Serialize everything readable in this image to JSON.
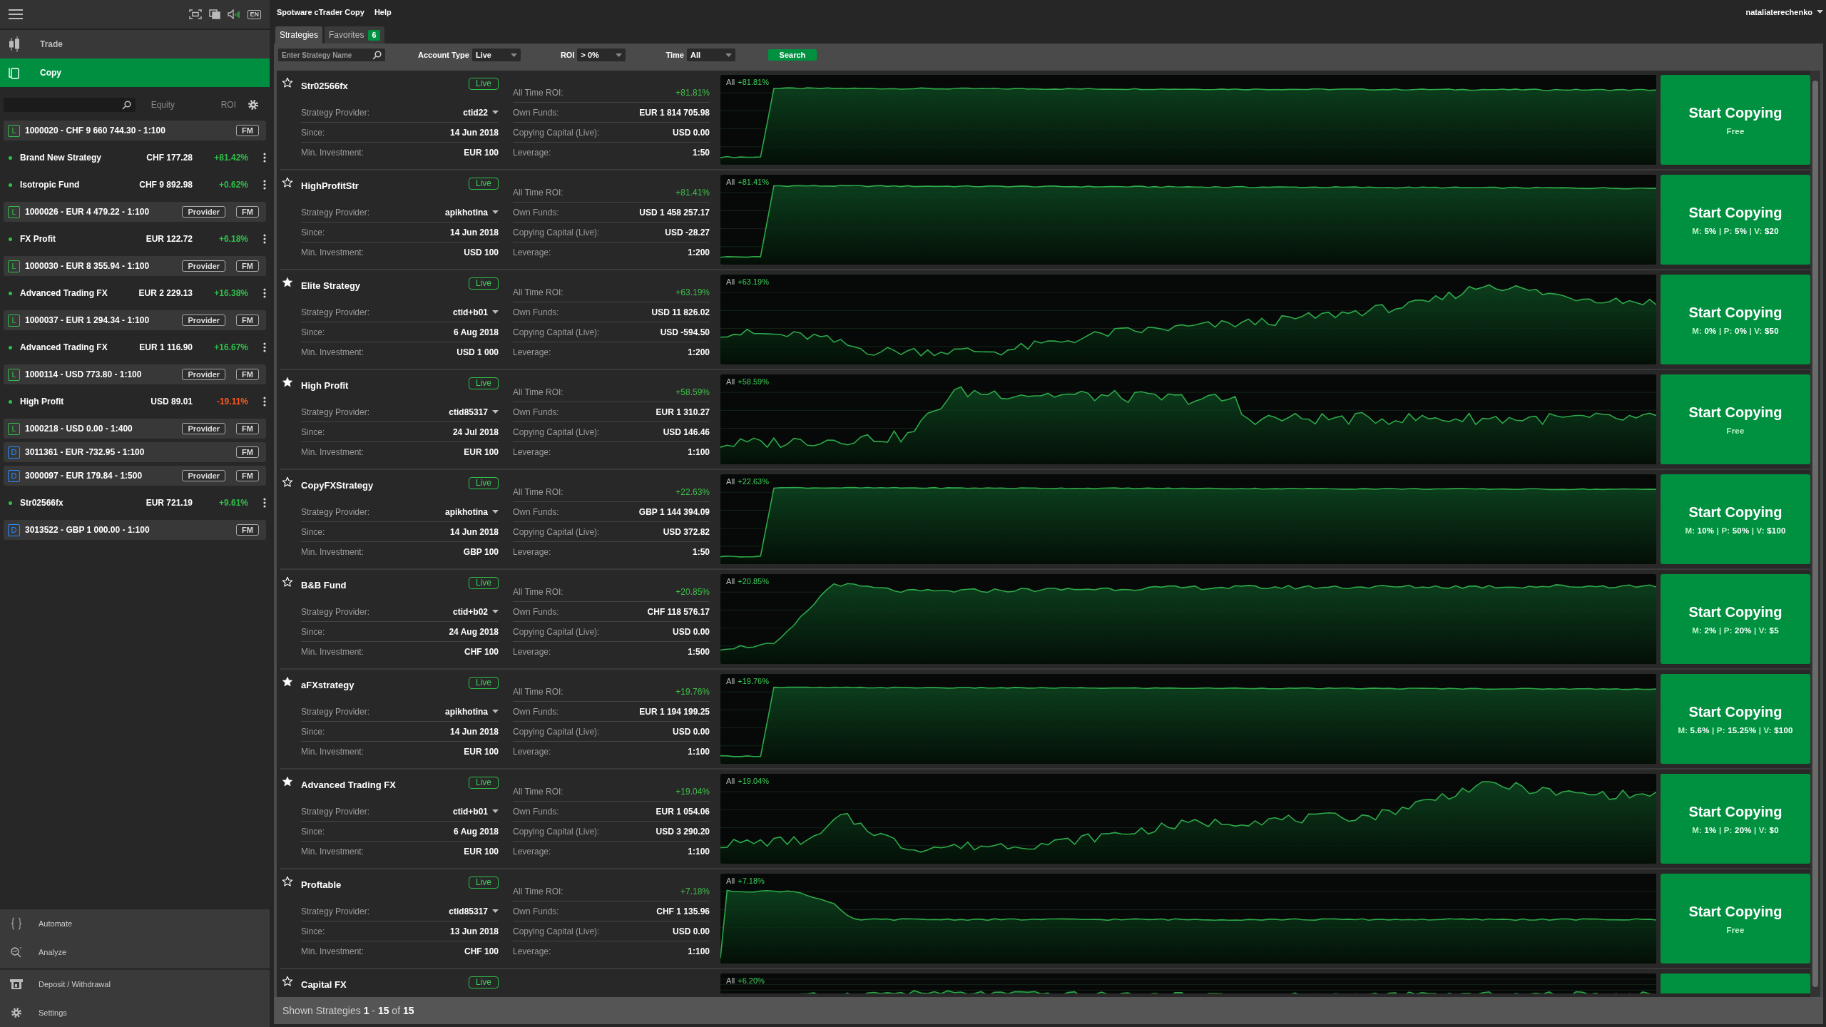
{
  "sidebar": {
    "language": "EN",
    "nav": [
      {
        "label": "Trade",
        "selected": false
      },
      {
        "label": "Copy",
        "selected": true
      }
    ],
    "columns": [
      "Equity",
      "ROI"
    ],
    "items": [
      {
        "kind": "account",
        "letter": "L",
        "color": "#2fbf4a",
        "text": "1000020 - CHF 9 660 744.30 - 1:100",
        "buttons": [
          "FM"
        ]
      },
      {
        "kind": "strategy",
        "name": "Brand New Strategy",
        "equity": "CHF 177.28",
        "roi": "+81.42%",
        "negative": false
      },
      {
        "kind": "strategy",
        "name": "Isotropic Fund",
        "equity": "CHF 9 892.98",
        "roi": "+0.62%",
        "negative": false
      },
      {
        "kind": "account",
        "letter": "L",
        "color": "#2fbf4a",
        "text": "1000026 - EUR 4 479.22 - 1:100",
        "buttons": [
          "Provider",
          "FM"
        ]
      },
      {
        "kind": "strategy",
        "name": "FX Profit",
        "equity": "EUR 122.72",
        "roi": "+6.18%",
        "negative": false
      },
      {
        "kind": "account",
        "letter": "L",
        "color": "#2fbf4a",
        "text": "1000030 - EUR 8 355.94 - 1:100",
        "buttons": [
          "Provider",
          "FM"
        ]
      },
      {
        "kind": "strategy",
        "name": "Advanced Trading FX",
        "equity": "EUR 2 229.13",
        "roi": "+16.38%",
        "negative": false
      },
      {
        "kind": "account",
        "letter": "L",
        "color": "#2fbf4a",
        "text": "1000037 - EUR 1 294.34 - 1:100",
        "buttons": [
          "Provider",
          "FM"
        ]
      },
      {
        "kind": "strategy",
        "name": "Advanced Trading FX",
        "equity": "EUR 1 116.90",
        "roi": "+16.67%",
        "negative": false
      },
      {
        "kind": "account",
        "letter": "L",
        "color": "#2fbf4a",
        "text": "1000114 - USD 773.80 - 1:100",
        "buttons": [
          "Provider",
          "FM"
        ]
      },
      {
        "kind": "strategy",
        "name": "High Profit",
        "equity": "USD 89.01",
        "roi": "-19.11%",
        "negative": true
      },
      {
        "kind": "account",
        "letter": "L",
        "color": "#2fbf4a",
        "text": "1000218 - USD 0.00 - 1:400",
        "buttons": [
          "Provider",
          "FM"
        ]
      },
      {
        "kind": "account",
        "letter": "D",
        "color": "#2a8cff",
        "text": "3011361 - EUR -732.95 - 1:100",
        "buttons": [
          "FM"
        ]
      },
      {
        "kind": "account",
        "letter": "D",
        "color": "#2a8cff",
        "text": "3000097 - EUR 179.84 - 1:500",
        "buttons": [
          "Provider",
          "FM"
        ]
      },
      {
        "kind": "strategy",
        "name": "Str02566fx",
        "equity": "EUR 721.19",
        "roi": "+9.61%",
        "negative": false
      },
      {
        "kind": "account",
        "letter": "D",
        "color": "#2a8cff",
        "text": "3013522 - GBP 1 000.00 - 1:100",
        "buttons": [
          "FM"
        ]
      }
    ],
    "tools": [
      {
        "kind": "automate",
        "label": "Automate"
      },
      {
        "kind": "analyze",
        "label": "Analyze"
      }
    ],
    "footer_nav": [
      {
        "kind": "deposit",
        "label": "Deposit / Withdrawal"
      },
      {
        "kind": "settings",
        "label": "Settings"
      }
    ]
  },
  "main": {
    "menu": [
      "Spotware cTrader Copy",
      "Help"
    ],
    "user": "nataliaterechenko",
    "tabs": [
      {
        "label": "Strategies",
        "selected": true
      },
      {
        "label": "Favorites",
        "count": "6",
        "selected": false
      }
    ],
    "filters": {
      "search": {
        "placeholder": "Enter Strategy Name"
      },
      "selects": [
        {
          "label": "Account Type",
          "value": "Live"
        },
        {
          "label": "ROI",
          "value": "> 0%"
        },
        {
          "label": "Time",
          "value": "All"
        }
      ],
      "button": "Search"
    },
    "strategies": [
      {
        "name": "Str02566fx",
        "favorite": false,
        "status": "Live",
        "info": [
          {
            "label": "Strategy Provider:",
            "value": "ctid22",
            "kind": "dropdown"
          },
          {
            "label": "Since:",
            "value": "14 Jun 2018"
          },
          {
            "label": "Min. Investment:",
            "value": "EUR 100"
          }
        ],
        "stats": [
          {
            "label": "All Time ROI:",
            "value": "+81.81%",
            "kind": "roi"
          },
          {
            "label": "Own Funds:",
            "value": "EUR 1 814 705.98"
          },
          {
            "label": "Copying Capital (Live):",
            "value": "USD 0.00"
          },
          {
            "label": "Leverage:",
            "value": "1:50"
          }
        ],
        "chart_period": "All",
        "chart_roi": "+81.81%",
        "action": "Start Copying",
        "terms": "Free"
      },
      {
        "name": "HighProfitStr",
        "favorite": false,
        "status": "Live",
        "info": [
          {
            "label": "Strategy Provider:",
            "value": "apikhotina",
            "kind": "dropdown"
          },
          {
            "label": "Since:",
            "value": "14 Jun 2018"
          },
          {
            "label": "Min. Investment:",
            "value": "USD 100"
          }
        ],
        "stats": [
          {
            "label": "All Time ROI:",
            "value": "+81.41%",
            "kind": "roi"
          },
          {
            "label": "Own Funds:",
            "value": "USD 1 458 257.17"
          },
          {
            "label": "Copying Capital (Live):",
            "value": "USD -28.27"
          },
          {
            "label": "Leverage:",
            "value": "1:200"
          }
        ],
        "chart_period": "All",
        "chart_roi": "+81.41%",
        "action": "Start Copying",
        "terms": "M: **5%** | P: **5%** | V: **$20**"
      },
      {
        "name": "Elite Strategy",
        "favorite": true,
        "status": "Live",
        "info": [
          {
            "label": "Strategy Provider:",
            "value": "ctid+b01",
            "kind": "dropdown"
          },
          {
            "label": "Since:",
            "value": "6 Aug 2018"
          },
          {
            "label": "Min. Investment:",
            "value": "USD 1 000"
          }
        ],
        "stats": [
          {
            "label": "All Time ROI:",
            "value": "+63.19%",
            "kind": "roi"
          },
          {
            "label": "Own Funds:",
            "value": "USD 11 826.02"
          },
          {
            "label": "Copying Capital (Live):",
            "value": "USD -594.50"
          },
          {
            "label": "Leverage:",
            "value": "1:200"
          }
        ],
        "chart_period": "All",
        "chart_roi": "+63.19%",
        "action": "Start Copying",
        "terms": "M: **0%** | P: **0%** | V: **$50**"
      },
      {
        "name": "High Profit",
        "favorite": true,
        "status": "Live",
        "info": [
          {
            "label": "Strategy Provider:",
            "value": "ctid85317",
            "kind": "dropdown"
          },
          {
            "label": "Since:",
            "value": "24 Jul 2018"
          },
          {
            "label": "Min. Investment:",
            "value": "EUR 100"
          }
        ],
        "stats": [
          {
            "label": "All Time ROI:",
            "value": "+58.59%",
            "kind": "roi"
          },
          {
            "label": "Own Funds:",
            "value": "EUR 1 310.27"
          },
          {
            "label": "Copying Capital (Live):",
            "value": "USD 146.46"
          },
          {
            "label": "Leverage:",
            "value": "1:100"
          }
        ],
        "chart_period": "All",
        "chart_roi": "+58.59%",
        "action": "Start Copying",
        "terms": "Free"
      },
      {
        "name": "CopyFXStrategy",
        "favorite": false,
        "status": "Live",
        "info": [
          {
            "label": "Strategy Provider:",
            "value": "apikhotina",
            "kind": "dropdown"
          },
          {
            "label": "Since:",
            "value": "14 Jun 2018"
          },
          {
            "label": "Min. Investment:",
            "value": "GBP 100"
          }
        ],
        "stats": [
          {
            "label": "All Time ROI:",
            "value": "+22.63%",
            "kind": "roi"
          },
          {
            "label": "Own Funds:",
            "value": "GBP 1 144 394.09"
          },
          {
            "label": "Copying Capital (Live):",
            "value": "USD 372.82"
          },
          {
            "label": "Leverage:",
            "value": "1:50"
          }
        ],
        "chart_period": "All",
        "chart_roi": "+22.63%",
        "action": "Start Copying",
        "terms": "M: **10%** | P: **50%** | V: **$100**"
      },
      {
        "name": "B&B Fund",
        "favorite": false,
        "status": "Live",
        "info": [
          {
            "label": "Strategy Provider:",
            "value": "ctid+b02",
            "kind": "dropdown"
          },
          {
            "label": "Since:",
            "value": "24 Aug 2018"
          },
          {
            "label": "Min. Investment:",
            "value": "CHF 100"
          }
        ],
        "stats": [
          {
            "label": "All Time ROI:",
            "value": "+20.85%",
            "kind": "roi"
          },
          {
            "label": "Own Funds:",
            "value": "CHF 118 576.17"
          },
          {
            "label": "Copying Capital (Live):",
            "value": "USD 0.00"
          },
          {
            "label": "Leverage:",
            "value": "1:500"
          }
        ],
        "chart_period": "All",
        "chart_roi": "+20.85%",
        "action": "Start Copying",
        "terms": "M: **2%** | P: **20%** | V: **$5**"
      },
      {
        "name": "aFXstrategy",
        "favorite": true,
        "status": "Live",
        "info": [
          {
            "label": "Strategy Provider:",
            "value": "apikhotina",
            "kind": "dropdown"
          },
          {
            "label": "Since:",
            "value": "14 Jun 2018"
          },
          {
            "label": "Min. Investment:",
            "value": "EUR 100"
          }
        ],
        "stats": [
          {
            "label": "All Time ROI:",
            "value": "+19.76%",
            "kind": "roi"
          },
          {
            "label": "Own Funds:",
            "value": "EUR 1 194 199.25"
          },
          {
            "label": "Copying Capital (Live):",
            "value": "USD 0.00"
          },
          {
            "label": "Leverage:",
            "value": "1:100"
          }
        ],
        "chart_period": "All",
        "chart_roi": "+19.76%",
        "action": "Start Copying",
        "terms": "M: **5.6%** | P: **15.25%** | V: **$100**"
      },
      {
        "name": "Advanced Trading FX",
        "favorite": true,
        "status": "Live",
        "info": [
          {
            "label": "Strategy Provider:",
            "value": "ctid+b01",
            "kind": "dropdown"
          },
          {
            "label": "Since:",
            "value": "6 Aug 2018"
          },
          {
            "label": "Min. Investment:",
            "value": "EUR 100"
          }
        ],
        "stats": [
          {
            "label": "All Time ROI:",
            "value": "+19.04%",
            "kind": "roi"
          },
          {
            "label": "Own Funds:",
            "value": "EUR 1 054.06"
          },
          {
            "label": "Copying Capital (Live):",
            "value": "USD 3 290.20"
          },
          {
            "label": "Leverage:",
            "value": "1:100"
          }
        ],
        "chart_period": "All",
        "chart_roi": "+19.04%",
        "action": "Start Copying",
        "terms": "M: **1%** | P: **20%** | V: **$0**"
      },
      {
        "name": "Proftable",
        "favorite": false,
        "status": "Live",
        "info": [
          {
            "label": "Strategy Provider:",
            "value": "ctid85317",
            "kind": "dropdown"
          },
          {
            "label": "Since:",
            "value": "13 Jun 2018"
          },
          {
            "label": "Min. Investment:",
            "value": "CHF 100"
          }
        ],
        "stats": [
          {
            "label": "All Time ROI:",
            "value": "+7.18%",
            "kind": "roi"
          },
          {
            "label": "Own Funds:",
            "value": "CHF 1 135.96"
          },
          {
            "label": "Copying Capital (Live):",
            "value": "USD 0.00"
          },
          {
            "label": "Leverage:",
            "value": "1:100"
          }
        ],
        "chart_period": "All",
        "chart_roi": "+7.18%",
        "action": "Start Copying",
        "terms": "Free"
      },
      {
        "name": "Capital FX",
        "favorite": false,
        "status": "Live",
        "chart_period": "All",
        "chart_roi": "+6.20%"
      }
    ],
    "footer": "Shown Strategies **1** - **15** of **15**"
  }
}
